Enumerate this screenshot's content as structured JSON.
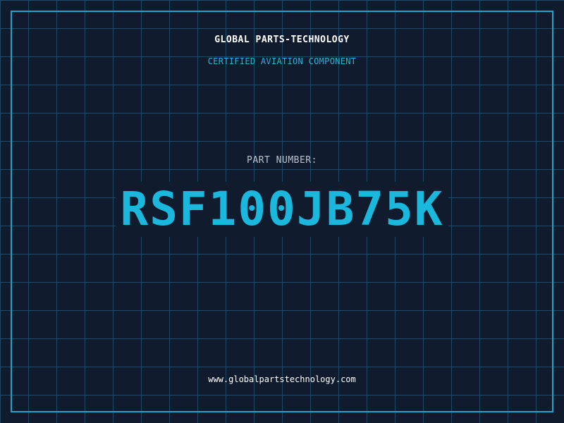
{
  "header": {
    "company": "GLOBAL PARTS-TECHNOLOGY",
    "tagline": "CERTIFIED AVIATION COMPONENT"
  },
  "part": {
    "label": "PART NUMBER:",
    "number": "RSF100JB75K"
  },
  "footer": {
    "url": "www.globalpartstechnology.com"
  },
  "colors": {
    "background": "#111b2e",
    "grid": "#1f4a66",
    "accent": "#1ab8dd",
    "border": "#22a3cc"
  }
}
